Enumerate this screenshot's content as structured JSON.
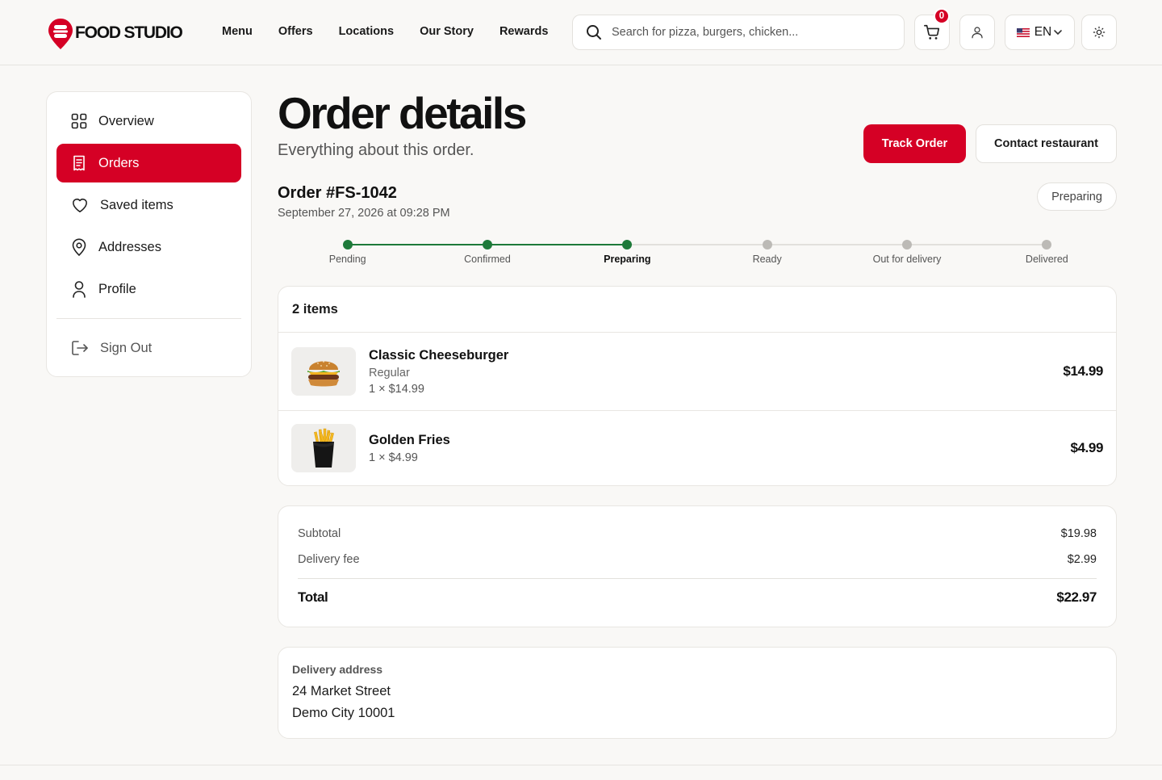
{
  "header": {
    "logo_text": "FOOD STUDIO",
    "nav": [
      "Menu",
      "Offers",
      "Locations",
      "Our Story",
      "Rewards"
    ],
    "search_placeholder": "Search for pizza, burgers, chicken...",
    "cart_count": "0",
    "language": "EN"
  },
  "sidebar": {
    "items": [
      {
        "label": "Overview",
        "icon": "grid-icon"
      },
      {
        "label": "Orders",
        "icon": "receipt-icon",
        "active": true
      },
      {
        "label": "Saved items",
        "icon": "heart-icon"
      },
      {
        "label": "Addresses",
        "icon": "map-pin-icon"
      },
      {
        "label": "Profile",
        "icon": "user-icon"
      }
    ],
    "signout": "Sign Out"
  },
  "main": {
    "title": "Order details",
    "subtitle": "Everything about this order.",
    "track_button": "Track Order",
    "contact_button": "Contact restaurant",
    "order_id": "Order #FS-1042",
    "order_date": "September 27, 2026 at 09:28 PM",
    "status": "Preparing"
  },
  "progress": {
    "steps": [
      "Pending",
      "Confirmed",
      "Preparing",
      "Ready",
      "Out for delivery",
      "Delivered"
    ],
    "current_index": 2,
    "done_color": "#1e7a3a",
    "pending_color": "#bcbab6"
  },
  "items": {
    "heading": "2 items",
    "list": [
      {
        "name": "Classic Cheeseburger",
        "variant": "Regular",
        "qty": "1 × $14.99",
        "price": "$14.99"
      },
      {
        "name": "Golden Fries",
        "variant": "",
        "qty": "1 × $4.99",
        "price": "$4.99"
      }
    ]
  },
  "totals": {
    "subtotal_label": "Subtotal",
    "subtotal": "$19.98",
    "delivery_label": "Delivery fee",
    "delivery": "$2.99",
    "total_label": "Total",
    "total": "$22.97"
  },
  "address": {
    "label": "Delivery address",
    "line1": "24 Market Street",
    "line2": "Demo City 10001"
  },
  "colors": {
    "accent": "#d50025"
  }
}
